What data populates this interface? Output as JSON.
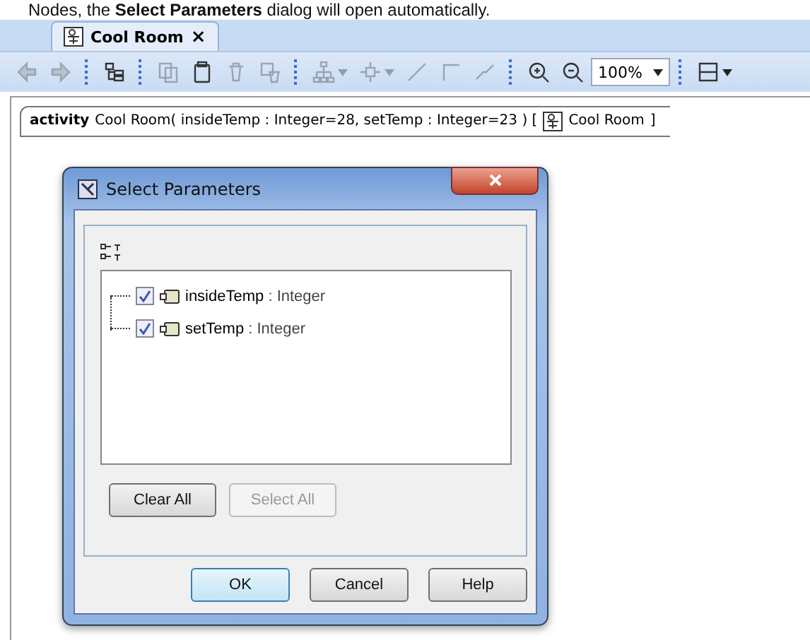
{
  "intro": "Nodes, the **Select Parameters** dialog will open automatically.",
  "tab": {
    "title": "Cool Room",
    "close": "×"
  },
  "toolbar": [
    {
      "kind": "back",
      "disabled": true
    },
    {
      "kind": "forward",
      "disabled": true
    },
    {
      "kind": "separator"
    },
    {
      "kind": "tree",
      "disabled": false
    },
    {
      "kind": "separator"
    },
    {
      "kind": "copy",
      "disabled": true
    },
    {
      "kind": "paste",
      "disabled": false
    },
    {
      "kind": "delete",
      "disabled": true
    },
    {
      "kind": "delete-model",
      "disabled": true
    },
    {
      "kind": "separator"
    },
    {
      "kind": "hierarchy",
      "disabled": true
    },
    {
      "kind": "node",
      "disabled": true
    },
    {
      "kind": "line",
      "disabled": true
    },
    {
      "kind": "rect-path",
      "disabled": true
    },
    {
      "kind": "zigzag",
      "disabled": true
    },
    {
      "kind": "separator"
    },
    {
      "kind": "zoom-in",
      "disabled": false
    },
    {
      "kind": "zoom-out",
      "disabled": false
    },
    {
      "kind": "zoom",
      "value": "100%"
    },
    {
      "kind": "separator"
    },
    {
      "kind": "layout",
      "disabled": false
    }
  ],
  "frame": {
    "keyword": "activity",
    "signature": "Cool Room( insideTemp : Integer=28, setTemp : Integer=23 ) [",
    "ref": "Cool Room",
    "close_bracket": "]"
  },
  "dialog": {
    "title": "Select Parameters",
    "items": [
      {
        "name": "insideTemp",
        "type": ": Integer",
        "checked": true
      },
      {
        "name": "setTemp",
        "type": ": Integer",
        "checked": true
      }
    ],
    "buttons": [
      {
        "label": "Clear All",
        "disabled": false
      },
      {
        "label": "Select All",
        "disabled": true
      }
    ],
    "footer": [
      {
        "label": "OK",
        "default": true
      },
      {
        "label": "Cancel",
        "default": false
      },
      {
        "label": "Help",
        "default": false
      }
    ]
  }
}
